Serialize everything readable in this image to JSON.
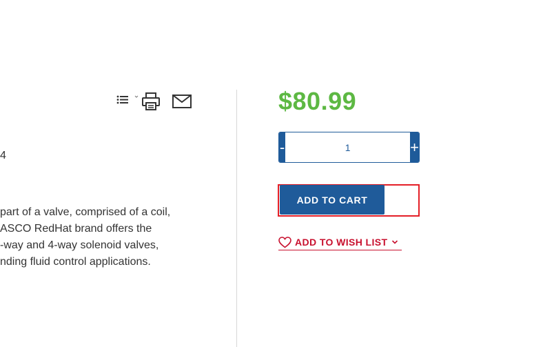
{
  "toolbar": {
    "icons": [
      "list-icon",
      "print-icon",
      "mail-icon"
    ]
  },
  "product": {
    "sku_fragment": "4",
    "description_lines": [
      "part of a valve, comprised of a coil,",
      "ASCO RedHat brand offers the",
      "-way and 4-way solenoid valves,",
      "nding fluid control applications."
    ]
  },
  "purchase": {
    "price": "$80.99",
    "quantity": {
      "decrement_label": "-",
      "value": "1",
      "increment_label": "+"
    },
    "add_to_cart_label": "ADD TO CART",
    "wishlist_label": "ADD TO WISH LIST"
  },
  "colors": {
    "price_green": "#5db843",
    "brand_blue": "#1f5b9a",
    "wishlist_red": "#c8102e",
    "highlight_red": "#e41e26"
  }
}
